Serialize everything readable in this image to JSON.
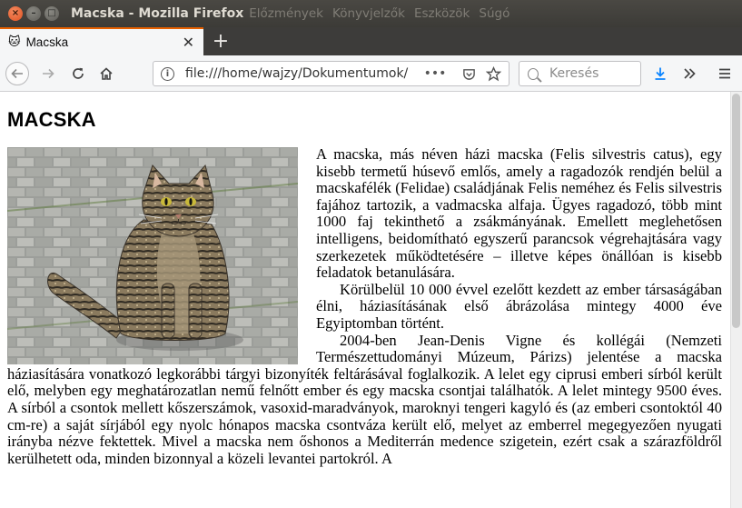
{
  "window": {
    "title": "Macska - Mozilla Firefox",
    "menu": [
      "Előzmények",
      "Könyvjelzők",
      "Eszközök",
      "Súgó"
    ]
  },
  "tab": {
    "label": "Macska",
    "favicon": "cat-face-icon"
  },
  "navbar": {
    "url": "file:///home/wajzy/Dokumentumok/",
    "search_placeholder": "Keresés"
  },
  "page": {
    "heading": "MACSKA",
    "paragraphs": [
      "A macska, más néven házi macska (Felis silvestris catus), egy kisebb termetű húsevő emlős, amely a ragadozók rendjén belül a macskafélék (Felidae) családjának Felis neméhez és Felis silvestris fajához tartozik, a vadmacska alfaja. Ügyes ragadozó, több mint 1000 faj tekinthető a zsákmányának. Emellett meglehetősen intelligens, beidomítható egyszerű parancsok végrehajtására vagy szerkezetek működtetésére – illetve képes önállóan is kisebb feladatok betanulására.",
      "Körülbelül 10 000 évvel ezelőtt kezdett az ember társaságában élni, háziasításának első ábrázolása mintegy 4000 éve Egyiptomban történt.",
      "2004-ben Jean-Denis Vigne és kollégái (Nemzeti Természettudományi Múzeum, Párizs) jelentése a macska háziasítására vonatkozó legkorábbi tárgyi bizonyíték feltárásával foglalkozik. A lelet egy ciprusi emberi sírból került elő, melyben egy meghatározatlan nemű felnőtt ember és egy macska csontjai találhatók. A lelet mintegy 9500 éves. A sírból a csontok mellett kőszerszámok, vasoxid-maradványok, maroknyi tengeri kagyló és (az emberi csontoktól 40 cm-re) a saját sírjából egy nyolc hónapos macska csontváza került elő, melyet az emberrel megegyezően nyugati irányba nézve fektettek. Mivel a macska nem őshonos a Mediterrán medence szigetein, ezért csak a szárazföldről kerülhetett oda, minden bizonnyal a közeli levantei partokról. A"
    ]
  }
}
